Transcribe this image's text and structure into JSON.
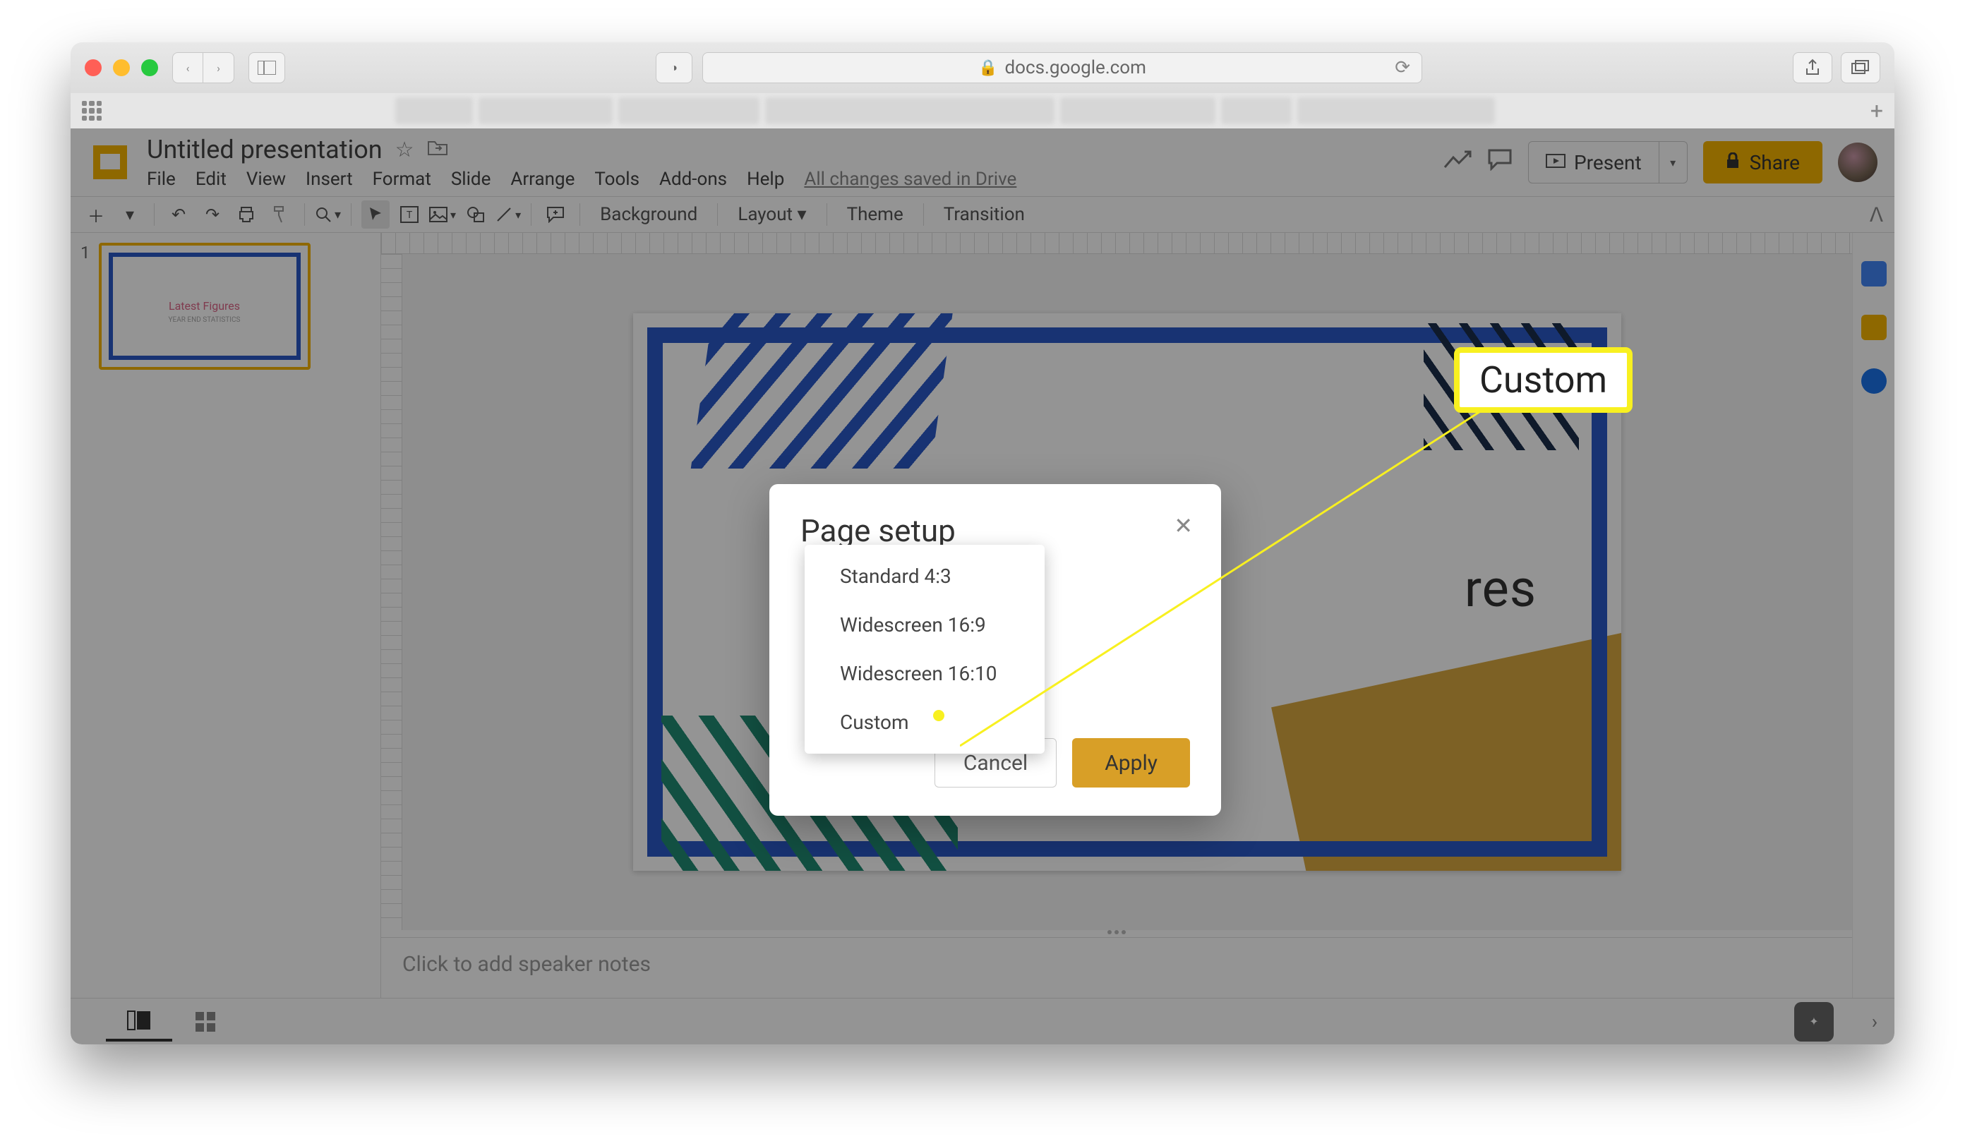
{
  "browser": {
    "url": "docs.google.com"
  },
  "doc": {
    "title": "Untitled presentation",
    "menus": [
      "File",
      "Edit",
      "View",
      "Insert",
      "Format",
      "Slide",
      "Arrange",
      "Tools",
      "Add-ons",
      "Help"
    ],
    "drive_status": "All changes saved in Drive",
    "present_label": "Present",
    "share_label": "Share"
  },
  "toolbar": {
    "background": "Background",
    "layout": "Layout",
    "theme": "Theme",
    "transition": "Transition"
  },
  "slides": {
    "thumb_number": "1",
    "thumb_title": "Latest Figures",
    "thumb_subtitle": "YEAR END STATISTICS",
    "main_title": "res"
  },
  "speaker_notes_placeholder": "Click to add speaker notes",
  "dialog": {
    "title": "Page setup",
    "options": [
      "Standard 4:3",
      "Widescreen 16:9",
      "Widescreen 16:10",
      "Custom"
    ],
    "cancel": "Cancel",
    "apply": "Apply"
  },
  "callout": "Custom"
}
